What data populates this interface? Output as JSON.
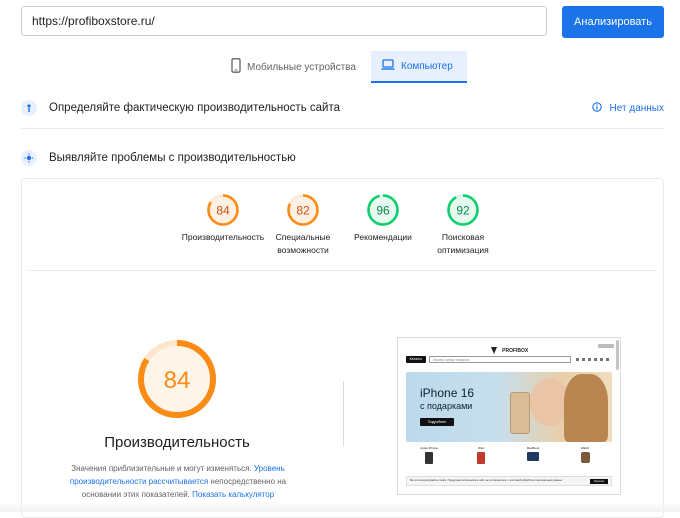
{
  "url_input": {
    "value": "https://profiboxstore.ru/"
  },
  "analyze_button": {
    "label": "Анализировать"
  },
  "tabs": [
    {
      "label": "Мобильные устройства",
      "active": false
    },
    {
      "label": "Компьютер",
      "active": true
    }
  ],
  "field_data": {
    "title": "Определяйте фактическую производительность сайта",
    "status": "Нет данных"
  },
  "lab": {
    "title": "Выявляйте проблемы с производительностью"
  },
  "scores": [
    {
      "label": "Производительность",
      "value": 84,
      "color": "#fa8b14"
    },
    {
      "label": "Специальные возможности",
      "value": 82,
      "color": "#fa8b14"
    },
    {
      "label": "Рекомендации",
      "value": 96,
      "color": "#0cce6b"
    },
    {
      "label": "Поисковая оптимизация",
      "value": 92,
      "color": "#0cce6b"
    }
  ],
  "main_score": {
    "value": 84,
    "label": "Производительность",
    "color": "#fa8b14"
  },
  "description": {
    "text1": "Значения приблизительные и могут изменяться.",
    "link1": "Уровень производительности рассчитывается",
    "text2": "непосредственно на основании этих показателей.",
    "link2": "Показать калькулятор"
  },
  "preview": {
    "logo": "PROFIBOX",
    "search_placeholder": "Искать среди товаров",
    "catalog_button": "Каталог",
    "hero_title": "iPhone 16",
    "hero_subtitle": "с подарками",
    "hero_button": "Подробнее",
    "cookie_text": "Мы используем файлы cookie. Продолжая использовать сайт, вы соглашаетесь с политикой обработки персональных данных",
    "cookie_button": "Хорошо",
    "products": [
      "Apple iPhone",
      "iPad",
      "MacBook",
      "Watch"
    ]
  },
  "colors": {
    "accent": "#1a73e8",
    "average": "#fa8b14",
    "good": "#0cce6b"
  }
}
